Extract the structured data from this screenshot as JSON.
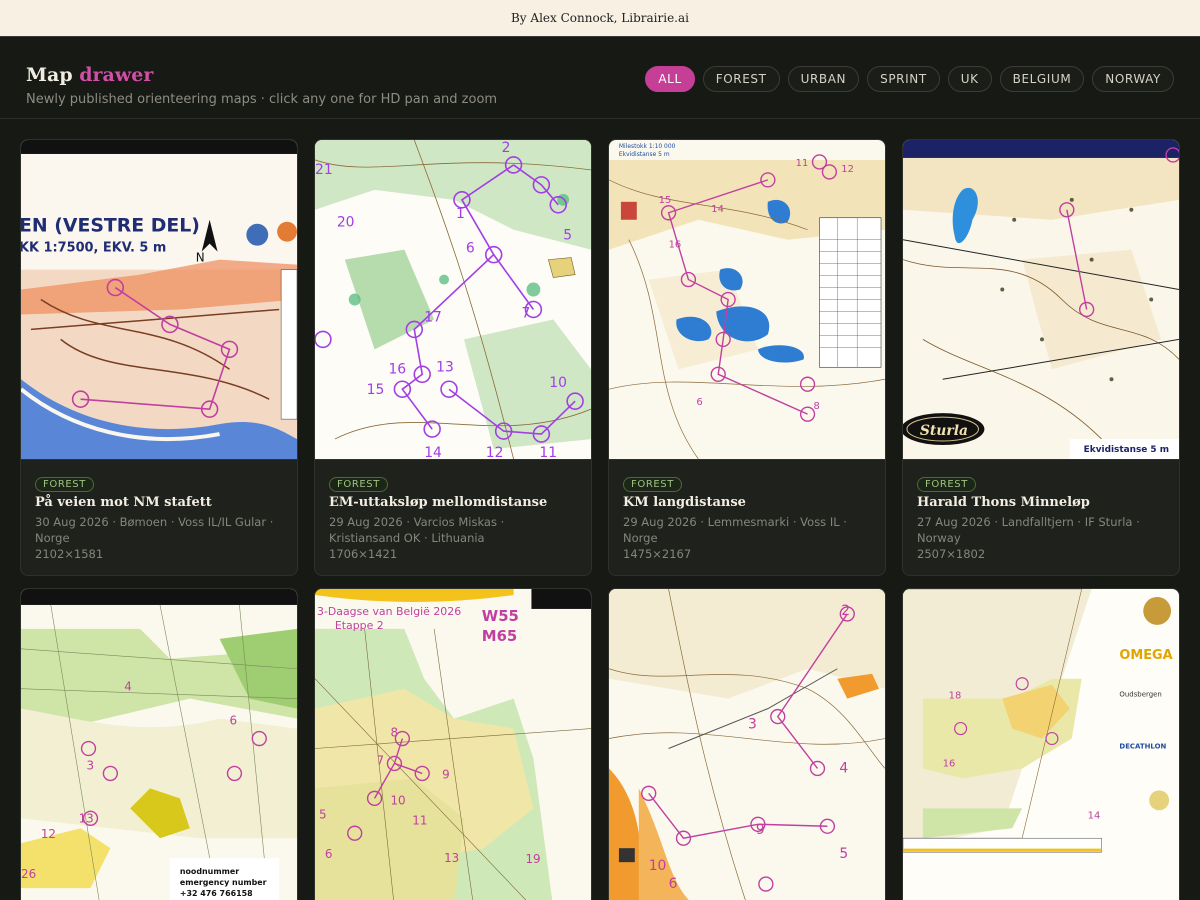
{
  "credit": "By Alex Connock, Librairie.ai",
  "header": {
    "brand_main": "Map",
    "brand_accent": "drawer",
    "subtitle": "Newly published orienteering maps · click any one for HD pan and zoom"
  },
  "filters": [
    "ALL",
    "FOREST",
    "URBAN",
    "SPRINT",
    "UK",
    "BELGIUM",
    "NORWAY"
  ],
  "active_filter": "ALL",
  "colors": {
    "accent": "#c53f97",
    "background": "#171914",
    "tag_green": "#9ec37d"
  },
  "cards": [
    {
      "tag": "FOREST",
      "title": "På veien mot NM stafett",
      "meta": "30 Aug 2026 · Bømoen · Voss IL/IL Gular · Norge",
      "dims": "2102×1581",
      "map_labels": [
        "EN (VESTRE DEL)",
        "KK 1:7500, EKV. 5 m",
        "N"
      ]
    },
    {
      "tag": "FOREST",
      "title": "EM-uttaksløp mellomdistanse",
      "meta": "29 Aug 2026 · Varcios Miskas · Kristiansand OK · Lithuania",
      "dims": "1706×1421",
      "map_labels": []
    },
    {
      "tag": "FOREST",
      "title": "KM langdistanse",
      "meta": "29 Aug 2026 · Lemmesmarki · Voss IL · Norge",
      "dims": "1475×2167",
      "map_labels": []
    },
    {
      "tag": "FOREST",
      "title": "Harald Thons Minneløp",
      "meta": "27 Aug 2026 · Landfalltjern · IF Sturla · Norway",
      "dims": "2507×1802",
      "map_labels": [
        "Sturla",
        "Ekvidistanse 5 m"
      ]
    },
    {
      "tag": "",
      "title": "",
      "meta": "",
      "dims": "",
      "map_labels": [
        "noodnummer",
        "emergency number",
        "+32 476 766158"
      ]
    },
    {
      "tag": "",
      "title": "",
      "meta": "",
      "dims": "",
      "map_labels": [
        "3-Daagse van België 2026",
        "Etappe 2",
        "W55",
        "M65"
      ]
    },
    {
      "tag": "",
      "title": "",
      "meta": "",
      "dims": "",
      "map_labels": []
    },
    {
      "tag": "",
      "title": "",
      "meta": "",
      "dims": "",
      "map_labels": [
        "OMEGA",
        "Oudsbergen",
        "DECATHLON"
      ]
    }
  ]
}
